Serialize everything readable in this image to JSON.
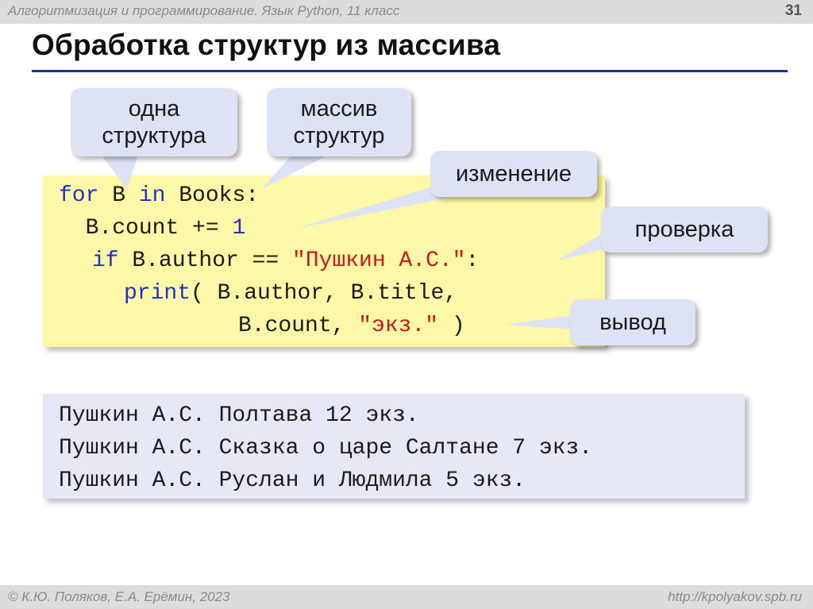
{
  "header": {
    "subject": "Алгоритмизация и программирование. Язык Python, 11 класс",
    "slide_number": "31"
  },
  "title": "Обработка структур из массива",
  "callouts": {
    "one_structure": [
      "одна",
      "структура"
    ],
    "array_structures": [
      "массив",
      "структур"
    ],
    "change": "изменение",
    "check": "проверка",
    "output": "вывод"
  },
  "code": {
    "line1": {
      "kw_for": "for",
      "var": " B ",
      "kw_in": "in",
      "rest": " Books:"
    },
    "line2": {
      "text": "  B.count += ",
      "num": "1"
    },
    "line3": {
      "kw_if": "if",
      "text": " B.author == ",
      "str": "\"Пушкин А.С.\"",
      "end": ":"
    },
    "line4": {
      "fn": "print",
      "text": "( B.author, B.title,"
    },
    "line5": {
      "text": "B.count, ",
      "str": "\"экз.\"",
      "end": " )"
    }
  },
  "output_lines": [
    "Пушкин А.С. Полтава 12 экз.",
    "Пушкин А.С. Сказка о царе Салтане 7 экз.",
    "Пушкин А.С. Руслан и Людмила 5 экз."
  ],
  "footer": {
    "copyright": "© К.Ю. Поляков, Е.А. Ерёмин, 2023",
    "url": "http://kpolyakov.spb.ru"
  },
  "colors": {
    "keyword": "#2030c8",
    "string": "#c81818",
    "code_bg": "#fdf8a8",
    "callout_bg": "#dde3f4",
    "title_rule": "#1e2f9a"
  }
}
